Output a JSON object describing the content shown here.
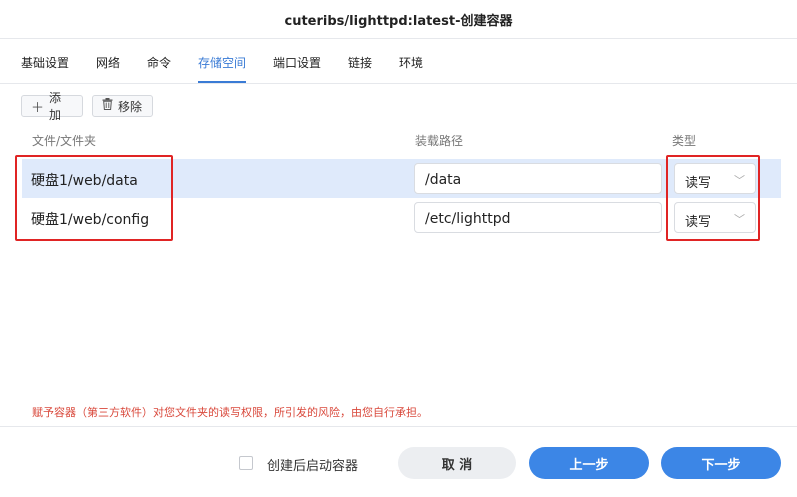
{
  "window": {
    "title": "cuteribs/lighttpd:latest-创建容器"
  },
  "tabs": [
    {
      "label": "基础设置"
    },
    {
      "label": "网络"
    },
    {
      "label": "命令"
    },
    {
      "label": "存储空间",
      "active": true
    },
    {
      "label": "端口设置"
    },
    {
      "label": "链接"
    },
    {
      "label": "环境"
    }
  ],
  "toolbar": {
    "add_label": "添加",
    "add_icon": "plus-icon",
    "remove_label": "移除",
    "remove_icon": "trash-icon"
  },
  "table": {
    "columns": [
      "文件/文件夹",
      "装载路径",
      "类型"
    ],
    "rows": [
      {
        "path": "硬盘1/web/data",
        "mount": "/data",
        "type": "读写",
        "selected": true
      },
      {
        "path": "硬盘1/web/config",
        "mount": "/etc/lighttpd",
        "type": "读写",
        "selected": false
      }
    ]
  },
  "warning": "赋予容器（第三方软件）对您文件夹的读写权限，所引发的风险，由您自行承担。",
  "footer": {
    "checkbox_label": "创建后启动容器",
    "checkbox_checked": false,
    "cancel_label": "取 消",
    "prev_label": "上一步",
    "next_label": "下一步"
  },
  "colors": {
    "accent": "#3a7bd5",
    "primary_button": "#3c86e6",
    "selected_row": "#dfeafb",
    "highlight_box": "#e02424",
    "warning_text": "#d9483b"
  }
}
